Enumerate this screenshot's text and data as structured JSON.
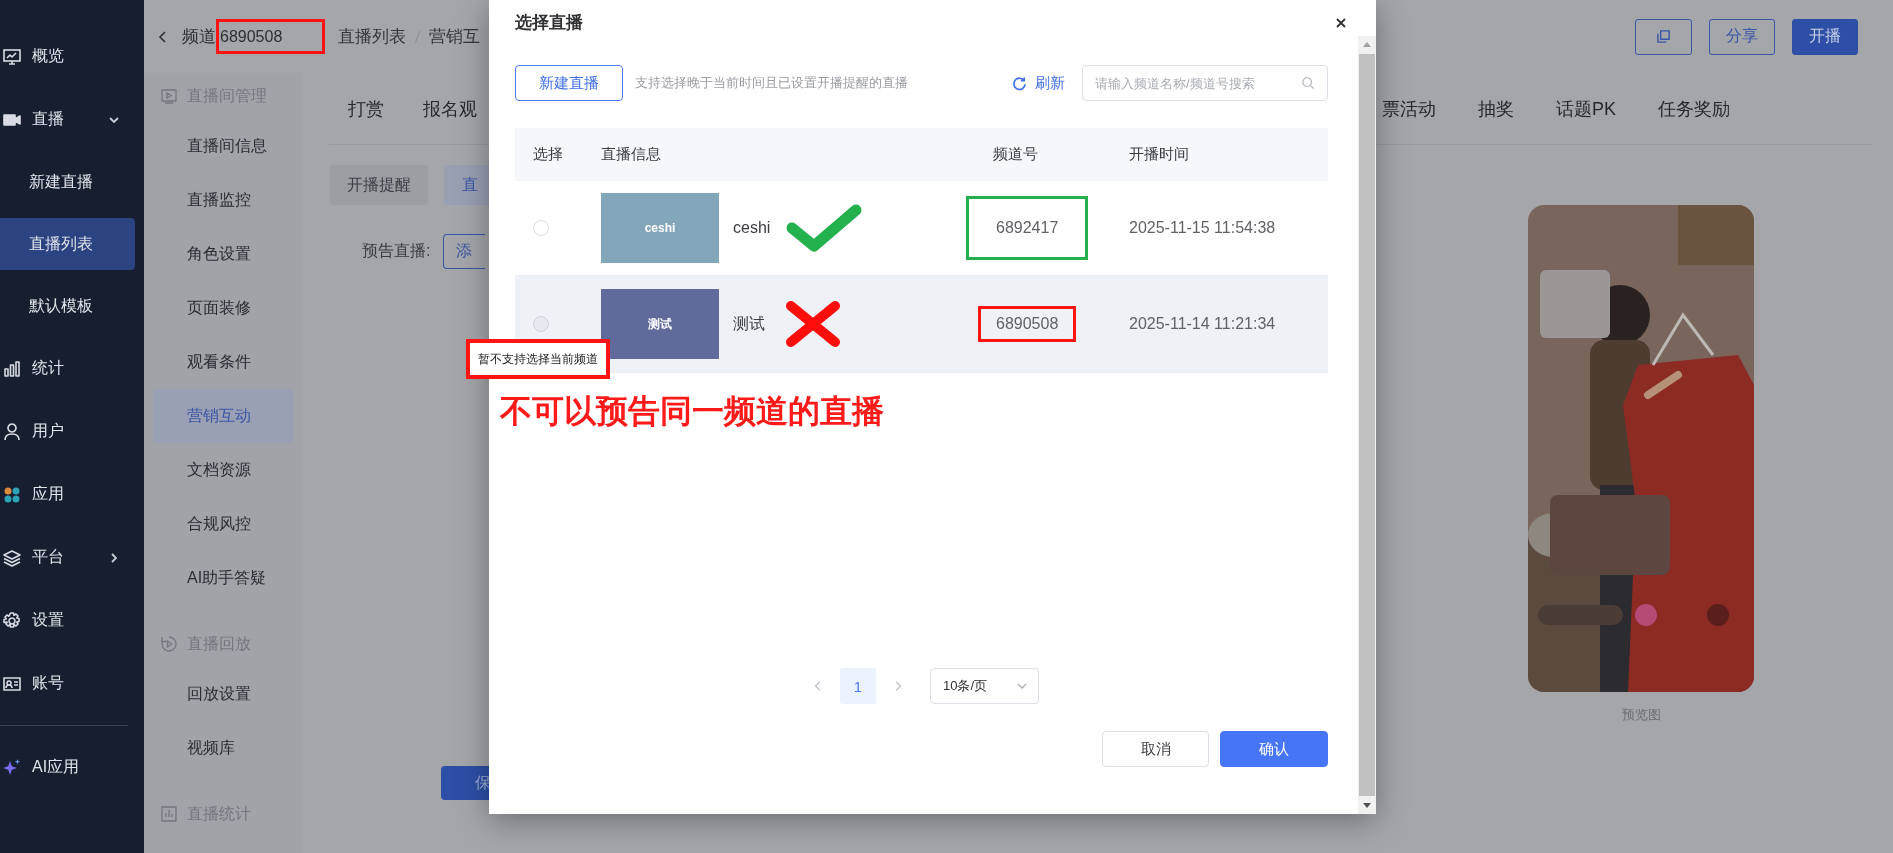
{
  "sidebar": {
    "items": [
      {
        "label": "概览",
        "selected": false
      },
      {
        "label": "直播",
        "selected": false,
        "expanded": true,
        "children": [
          {
            "label": "新建直播",
            "selected": false
          },
          {
            "label": "直播列表",
            "selected": true
          },
          {
            "label": "默认模板",
            "selected": false
          }
        ]
      },
      {
        "label": "统计",
        "selected": false
      },
      {
        "label": "用户",
        "selected": false
      },
      {
        "label": "应用",
        "selected": false
      },
      {
        "label": "平台",
        "selected": false,
        "expanded": false
      },
      {
        "label": "设置",
        "selected": false
      },
      {
        "label": "账号",
        "selected": false
      }
    ],
    "extra": {
      "label": "AI应用",
      "selected": false
    }
  },
  "header": {
    "channel_label": "频道",
    "channel_id": "6890508",
    "breadcrumb": [
      "直播列表",
      "营销互"
    ],
    "actions": [
      {
        "kind": "icon"
      },
      {
        "kind": "outline",
        "label": "分享"
      },
      {
        "kind": "primary",
        "label": "开播"
      }
    ]
  },
  "subnav": {
    "sections": [
      {
        "title": "直播间管理",
        "items": [
          {
            "label": "直播间信息",
            "selected": false
          },
          {
            "label": "直播监控",
            "selected": false
          },
          {
            "label": "角色设置",
            "selected": false
          },
          {
            "label": "页面装修",
            "selected": false
          },
          {
            "label": "观看条件",
            "selected": false
          },
          {
            "label": "营销互动",
            "selected": true
          },
          {
            "label": "文档资源",
            "selected": false
          },
          {
            "label": "合规风控",
            "selected": false
          },
          {
            "label": "AI助手答疑",
            "selected": false
          }
        ]
      },
      {
        "title": "直播回放",
        "items": [
          {
            "label": "回放设置",
            "selected": false
          },
          {
            "label": "视频库",
            "selected": false
          }
        ]
      },
      {
        "title": "直播统计"
      }
    ]
  },
  "tabs_left": [
    {
      "label": "打赏",
      "selected": false
    },
    {
      "label": "报名观",
      "selected": false
    }
  ],
  "tabs_right": [
    {
      "label": "票活动",
      "selected": false
    },
    {
      "label": "抽奖",
      "selected": false
    },
    {
      "label": "话题PK",
      "selected": false
    },
    {
      "label": "任务奖励",
      "selected": false
    }
  ],
  "subtabs": [
    {
      "label": "开播提醒",
      "selected": false
    },
    {
      "label": "直",
      "selected": true
    }
  ],
  "form": {
    "label": "预告直播:",
    "button": "添",
    "save": "保"
  },
  "preview": {
    "caption": "预览图"
  },
  "dialog": {
    "title": "选择直播",
    "new_button": "新建直播",
    "hint": "支持选择晚于当前时间且已设置开播提醒的直播",
    "refresh": "刷新",
    "search": {
      "placeholder": "请输入频道名称/频道号搜索"
    },
    "columns": [
      "选择",
      "直播信息",
      "频道号",
      "开播时间"
    ],
    "rows": [
      {
        "selected": false,
        "disabled": false,
        "hovered": false,
        "cover_text": "ceshi",
        "color": "#84a6ba",
        "name": "ceshi",
        "channel": "6892417",
        "start_time": "2025-11-15 11:54:38",
        "kind": "check"
      },
      {
        "selected": false,
        "disabled": true,
        "hovered": true,
        "cover_text": "测试",
        "color": "#606b9c",
        "name": "测试",
        "channel": "6890508",
        "start_time": "2025-11-14 11:21:34",
        "kind": "cross"
      }
    ],
    "tooltip": "暂不支持选择当前频道",
    "note": "不可以预告同一频道的直播",
    "pagination": {
      "pages": [
        {
          "label": "1",
          "selected": true
        }
      ],
      "page_size": "10条/页"
    },
    "buttons": [
      {
        "kind": "default",
        "label": "取消"
      },
      {
        "kind": "primary",
        "label": "确认"
      }
    ]
  }
}
